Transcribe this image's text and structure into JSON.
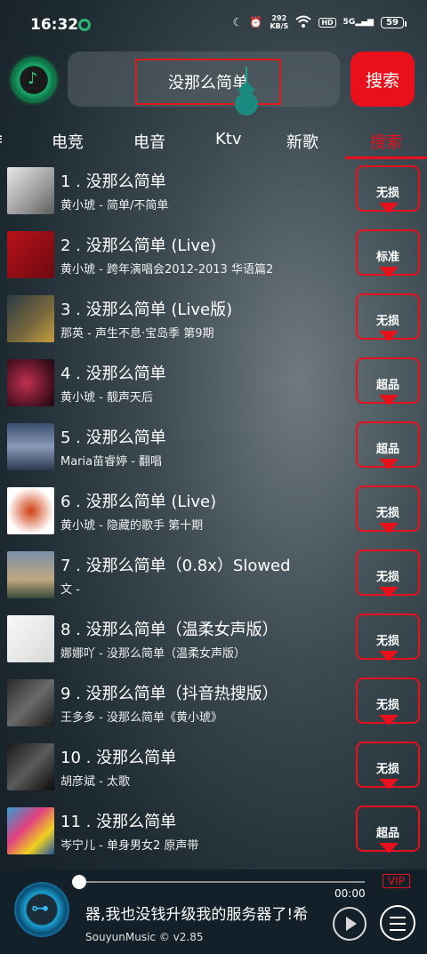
{
  "status_bar": {
    "time": "16:32",
    "speed_value": "292",
    "speed_unit": "KB/S",
    "hd": "HD",
    "signal": "5G",
    "battery": "59"
  },
  "search": {
    "value": "没那么简单",
    "button_label": "搜索"
  },
  "tabs": [
    {
      "label": "电竞"
    },
    {
      "label": "电音"
    },
    {
      "label": "Ktv"
    },
    {
      "label": "新歌"
    },
    {
      "label": "搜索",
      "active": true
    }
  ],
  "songs": [
    {
      "title": "1 . 没那么简单",
      "subtitle": "黄小琥 - 简单/不简单",
      "quality": "无损"
    },
    {
      "title": "2 . 没那么简单 (Live)",
      "subtitle": "黄小琥 - 跨年演唱会2012-2013 华语篇2",
      "quality": "标准"
    },
    {
      "title": "3 . 没那么简单 (Live版)",
      "subtitle": "那英 - 声生不息·宝岛季 第9期",
      "quality": "无损"
    },
    {
      "title": "4 . 没那么简单",
      "subtitle": "黄小琥 - 靓声天后",
      "quality": "超品"
    },
    {
      "title": "5 . 没那么简单",
      "subtitle": "Maria苗睿婷 - 翻唱",
      "quality": "超品"
    },
    {
      "title": "6 . 没那么简单 (Live)",
      "subtitle": "黄小琥 - 隐藏的歌手 第十期",
      "quality": "无损"
    },
    {
      "title": "7 . 没那么简单（0.8x）Slowed",
      "subtitle": "文 -",
      "quality": "无损"
    },
    {
      "title": "8 . 没那么简单（温柔女声版）",
      "subtitle": "娜娜吖 - 没那么简单（温柔女声版）",
      "quality": "无损"
    },
    {
      "title": "9 . 没那么简单（抖音热搜版）",
      "subtitle": "王多多 - 没那么简单《黄小琥》",
      "quality": "无损"
    },
    {
      "title": "10 . 没那么简单",
      "subtitle": "胡彦斌 - 太歌",
      "quality": "无损"
    },
    {
      "title": "11 . 没那么简单",
      "subtitle": "岑宁儿 - 单身男女2 原声带",
      "quality": "超品"
    }
  ],
  "player": {
    "time": "00:00",
    "vip": "VIP",
    "marquee": "器,我也没钱升级我的服务器了!希",
    "version": "SouyunMusic © v2.85",
    "progress": 0
  },
  "colors": {
    "accent": "#e8101a",
    "logo_green": "#2cd07e",
    "player_blue": "#1aa0d0"
  }
}
